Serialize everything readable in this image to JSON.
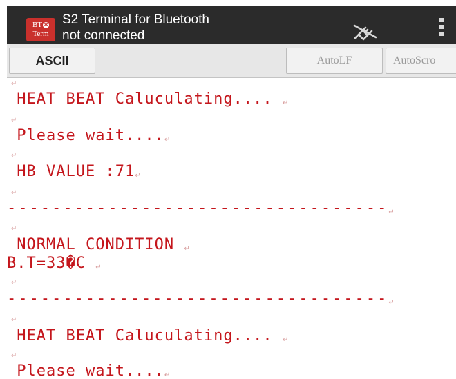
{
  "app": {
    "icon_text_line1": "BT",
    "icon_text_line2": "Term",
    "title": "S2 Terminal for Bluetooth",
    "subtitle": "not connected",
    "connect_icon": "plug-disconnected-icon",
    "overflow_icon": "overflow-menu-icon"
  },
  "toolbar": {
    "ascii_label": "ASCII",
    "autolf_label": "AutoLF",
    "autoscroll_label": "AutoScro"
  },
  "colors": {
    "terminal_text": "#c4161c",
    "actionbar": "#2b2b2b",
    "app_icon": "#c9302c"
  },
  "line_end_symbol": "↵",
  "terminal": {
    "lines": [
      " HEAT BEAT Caluculating.... ",
      " Please wait....",
      " HB VALUE :71",
      "----------------------------------",
      " NORMAL CONDITION ",
      "B.T=33�C ",
      "----------------------------------",
      " HEAT BEAT Caluculating.... ",
      " Please wait...."
    ]
  }
}
